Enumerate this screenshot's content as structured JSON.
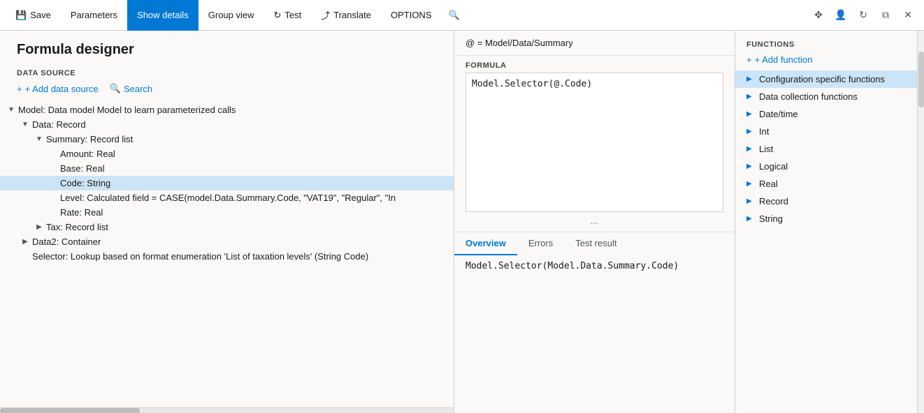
{
  "titlebar": {
    "save": "Save",
    "parameters": "Parameters",
    "show_details": "Show details",
    "group_view": "Group view",
    "test": "Test",
    "translate": "Translate",
    "options": "OPTIONS"
  },
  "left_panel": {
    "title": "Formula designer",
    "datasource_label": "DATA SOURCE",
    "add_datasource": "+ Add data source",
    "search": "Search",
    "tree": [
      {
        "id": "model",
        "indent": 0,
        "arrow": "expanded",
        "text": "Model: Data model Model to learn parameterized calls"
      },
      {
        "id": "data",
        "indent": 1,
        "arrow": "expanded",
        "text": "Data: Record"
      },
      {
        "id": "summary",
        "indent": 2,
        "arrow": "expanded",
        "text": "Summary: Record list"
      },
      {
        "id": "amount",
        "indent": 3,
        "arrow": "leaf",
        "text": "Amount: Real"
      },
      {
        "id": "base",
        "indent": 3,
        "arrow": "leaf",
        "text": "Base: Real"
      },
      {
        "id": "code",
        "indent": 3,
        "arrow": "leaf",
        "text": "Code: String",
        "selected": true
      },
      {
        "id": "level",
        "indent": 3,
        "arrow": "leaf",
        "text": "Level: Calculated field = CASE(model.Data.Summary.Code, \"VAT19\", \"Regular\", \"In"
      },
      {
        "id": "rate",
        "indent": 3,
        "arrow": "leaf",
        "text": "Rate: Real"
      },
      {
        "id": "tax",
        "indent": 2,
        "arrow": "collapsed",
        "text": "Tax: Record list"
      },
      {
        "id": "data2",
        "indent": 1,
        "arrow": "collapsed",
        "text": "Data2: Container"
      },
      {
        "id": "selector",
        "indent": 1,
        "arrow": "leaf",
        "text": "Selector: Lookup based on format enumeration 'List of taxation levels' (String Code)"
      }
    ]
  },
  "middle_panel": {
    "formula_path": "@ = Model/Data/Summary",
    "formula_label": "FORMULA",
    "formula_content": "Model.Selector(@.Code)",
    "dots": "...",
    "tabs": [
      {
        "id": "overview",
        "label": "Overview",
        "active": true
      },
      {
        "id": "errors",
        "label": "Errors",
        "active": false
      },
      {
        "id": "test_result",
        "label": "Test result",
        "active": false
      }
    ],
    "result_text": "Model.Selector(Model.Data.Summary.Code)"
  },
  "right_panel": {
    "functions_label": "FUNCTIONS",
    "add_function": "+ Add function",
    "items": [
      {
        "id": "config",
        "label": "Configuration specific functions",
        "selected": true
      },
      {
        "id": "datacollection",
        "label": "Data collection functions",
        "selected": false
      },
      {
        "id": "datetime",
        "label": "Date/time",
        "selected": false
      },
      {
        "id": "int",
        "label": "Int",
        "selected": false
      },
      {
        "id": "list",
        "label": "List",
        "selected": false
      },
      {
        "id": "logical",
        "label": "Logical",
        "selected": false
      },
      {
        "id": "real",
        "label": "Real",
        "selected": false
      },
      {
        "id": "record",
        "label": "Record",
        "selected": false
      },
      {
        "id": "string",
        "label": "String",
        "selected": false
      }
    ]
  },
  "icons": {
    "save": "💾",
    "test": "↻",
    "translate": "⤴",
    "search": "🔍",
    "plus": "+",
    "settings1": "⊞",
    "settings2": "👤",
    "refresh": "↺",
    "restore": "⤢",
    "close": "✕",
    "arrow_right": "▶"
  }
}
